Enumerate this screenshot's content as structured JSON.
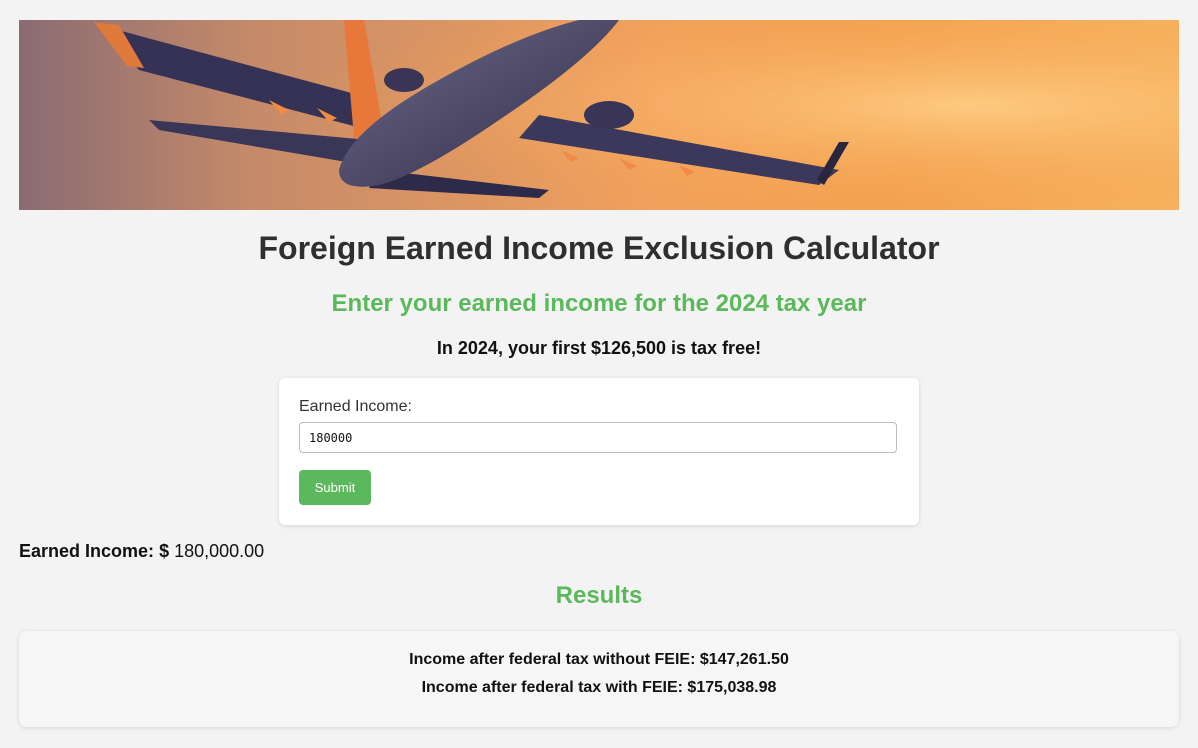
{
  "banner": {
    "icon": "airplane-image"
  },
  "page": {
    "title": "Foreign Earned Income Exclusion Calculator",
    "subtitle": "Enter your earned income for the 2024 tax year",
    "note": "In 2024, your first $126,500 is tax free!"
  },
  "form": {
    "label": "Earned Income:",
    "input_value": "180000",
    "submit_label": "Submit"
  },
  "summary": {
    "label": "Earned Income:",
    "currency": "$",
    "value": "180,000.00"
  },
  "results": {
    "heading": "Results",
    "without_feie": "Income after federal tax without FEIE: $147,261.50",
    "with_feie": "Income after federal tax with FEIE: $175,038.98"
  },
  "colors": {
    "accent": "#5cb85c",
    "background": "#f3f3f3",
    "title": "#2f2f2f"
  }
}
